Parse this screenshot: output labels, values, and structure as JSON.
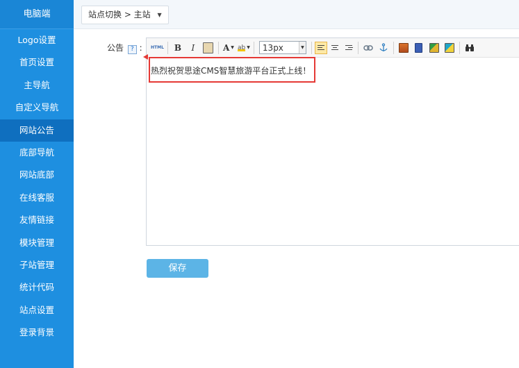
{
  "sidebar": {
    "header": "电脑端",
    "items": [
      {
        "label": "Logo设置"
      },
      {
        "label": "首页设置"
      },
      {
        "label": "主导航"
      },
      {
        "label": "自定义导航"
      },
      {
        "label": "网站公告",
        "active": true
      },
      {
        "label": "底部导航"
      },
      {
        "label": "网站底部"
      },
      {
        "label": "在线客服"
      },
      {
        "label": "友情链接"
      },
      {
        "label": "模块管理"
      },
      {
        "label": "子站管理"
      },
      {
        "label": "统计代码"
      },
      {
        "label": "站点设置"
      },
      {
        "label": "登录背景"
      }
    ]
  },
  "topbar": {
    "site_switch_label": "站点切换 > 主站"
  },
  "form": {
    "field_label": "公告",
    "help_symbol": "?",
    "colon": ":"
  },
  "editor": {
    "toolbar": {
      "html_label": "HTML",
      "bold_label": "B",
      "italic_label": "I",
      "font_color_label": "A",
      "highlight_label": "ab",
      "font_size_value": "13px"
    },
    "content": "热烈祝贺思途CMS智慧旅游平台正式上线！"
  },
  "actions": {
    "save_label": "保存"
  },
  "colors": {
    "sidebar_bg": "#1e8fe0",
    "sidebar_active": "#0f6fbf",
    "save_button": "#5cb4e6",
    "highlight": "#e53935"
  }
}
